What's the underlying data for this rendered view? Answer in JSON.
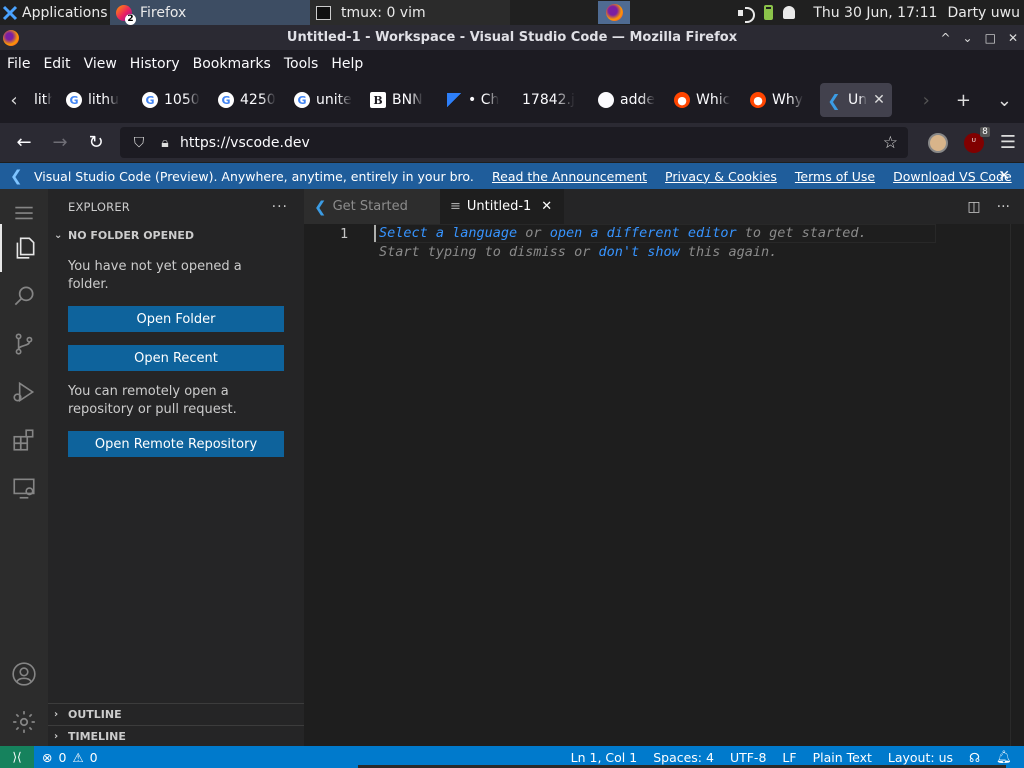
{
  "taskbar": {
    "applications_label": "Applications",
    "firefox_task": "Firefox",
    "firefox_badge": "2",
    "tmux_task": "tmux: 0 vim",
    "clock": "Thu 30 Jun, 17:11",
    "user": "Darty uwu"
  },
  "window": {
    "title": "Untitled-1 - Workspace - Visual Studio Code — Mozilla Firefox"
  },
  "menu": [
    "File",
    "Edit",
    "View",
    "History",
    "Bookmarks",
    "Tools",
    "Help"
  ],
  "tabs": [
    {
      "label": "lithu",
      "fav": "none"
    },
    {
      "label": "lithu",
      "fav": "g"
    },
    {
      "label": "1050",
      "fav": "g"
    },
    {
      "label": "4250",
      "fav": "g"
    },
    {
      "label": "unite",
      "fav": "g"
    },
    {
      "label": "BNN",
      "fav": "b"
    },
    {
      "label": "• Ch",
      "fav": "z"
    },
    {
      "label": "17842.j",
      "fav": "none"
    },
    {
      "label": "adde",
      "fav": "gh"
    },
    {
      "label": "Whic",
      "fav": "rd"
    },
    {
      "label": "Why",
      "fav": "rd"
    },
    {
      "label": "Un",
      "fav": "vs",
      "selected": true
    }
  ],
  "nav": {
    "url": "https://vscode.dev",
    "ublock_count": "8"
  },
  "notice": {
    "message": "Visual Studio Code (Preview). Anywhere, anytime, entirely in your bro...",
    "links": [
      "Read the Announcement",
      "Privacy & Cookies",
      "Terms of Use",
      "Download VS Code"
    ]
  },
  "sidebar": {
    "title": "EXPLORER",
    "section": "NO FOLDER OPENED",
    "text1": "You have not yet opened a folder.",
    "open_folder": "Open Folder",
    "open_recent": "Open Recent",
    "text2": "You can remotely open a repository or pull request.",
    "open_remote": "Open Remote Repository",
    "outline": "OUTLINE",
    "timeline": "TIMELINE"
  },
  "editor_tabs": [
    {
      "label": "Get Started",
      "active": false
    },
    {
      "label": "Untitled-1",
      "active": true
    }
  ],
  "editor": {
    "line_number": "1",
    "hint_line1": {
      "a1": "Select a language",
      "t1": " or ",
      "a2": "open a different editor",
      "t2": " to get started."
    },
    "hint_line2": {
      "t1": "Start typing to dismiss or ",
      "a1": "don't show",
      "t2": " this again."
    }
  },
  "status": {
    "errors": "0",
    "warnings": "0",
    "position": "Ln 1, Col 1",
    "spaces": "Spaces: 4",
    "encoding": "UTF-8",
    "eol": "LF",
    "language": "Plain Text",
    "layout": "Layout: us"
  },
  "colors": {
    "accent": "#007acc",
    "button": "#0e639c",
    "notice": "#1f5d9b",
    "link": "#3794ff"
  }
}
